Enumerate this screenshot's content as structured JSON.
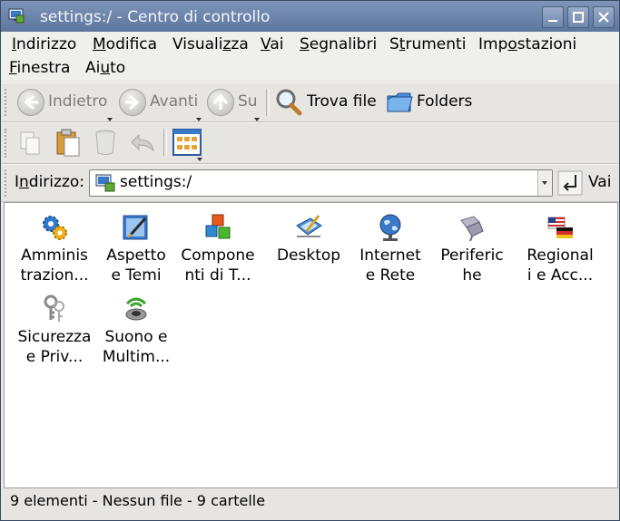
{
  "window": {
    "title": "settings:/ - Centro di controllo"
  },
  "menubar": {
    "items": [
      {
        "label": "Indirizzo",
        "u": "I"
      },
      {
        "label": "Modifica",
        "u": "M"
      },
      {
        "label": "Visualizza",
        "u": "z"
      },
      {
        "label": "Vai",
        "u": "V"
      },
      {
        "label": "Segnalibri",
        "u": "S"
      },
      {
        "label": "Strumenti",
        "u": "t"
      },
      {
        "label": "Impostazioni",
        "u": "o"
      },
      {
        "label": "Finestra",
        "u": "F"
      },
      {
        "label": "Aiuto",
        "u": "u"
      }
    ]
  },
  "toolbar": {
    "back_label": "Indietro",
    "forward_label": "Avanti",
    "up_label": "Su",
    "find_label": "Trova file",
    "folders_label": "Folders"
  },
  "address": {
    "label": "Indirizzo:",
    "value": "settings:/",
    "go_label": "Vai"
  },
  "items": [
    {
      "line1": "Amminis",
      "line2": "trazion...",
      "icon": "gears-icon"
    },
    {
      "line1": "Aspetto",
      "line2": "e Temi",
      "icon": "paintbrush-icon"
    },
    {
      "line1": "Compone",
      "line2": "nti di T...",
      "icon": "blocks-icon"
    },
    {
      "line1": "Desktop",
      "line2": "",
      "icon": "desktop-pen-icon"
    },
    {
      "line1": "Internet",
      "line2": "e Rete",
      "icon": "globe-icon"
    },
    {
      "line1": "Periferic",
      "line2": "he",
      "icon": "usb-plug-icon"
    },
    {
      "line1": "Regional",
      "line2": "i e Acc...",
      "icon": "flags-icon"
    },
    {
      "line1": "Sicurezza",
      "line2": "e Priv...",
      "icon": "keys-icon"
    },
    {
      "line1": "Suono e",
      "line2": "Multim...",
      "icon": "speaker-icon"
    }
  ],
  "status": {
    "text": "9 elementi - Nessun file - 9 cartelle"
  },
  "colors": {
    "titlebar": "#6a82aa",
    "accent": "#3a78c8"
  }
}
